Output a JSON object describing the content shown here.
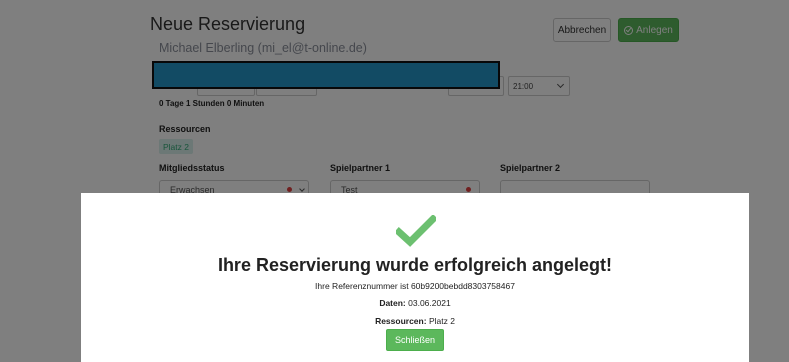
{
  "form": {
    "title": "Neue Reservierung",
    "user": "Michael Elberling (mi_el@t-online.de)",
    "cancel_label": "Abbrechen",
    "create_label": "Anlegen",
    "end_time": "21:00",
    "duration": "0 Tage 1 Stunden 0 Minuten",
    "resources_label": "Ressourcen",
    "resource_tag": "Platz 2",
    "membership_label": "Mitgliedsstatus",
    "membership_value": "Erwachsen",
    "partner1_label": "Spielpartner 1",
    "partner1_value": "Test",
    "partner2_label": "Spielpartner 2",
    "partner2_value": ""
  },
  "modal": {
    "icon": "check-icon",
    "title": "Ihre Reservierung wurde erfolgreich angelegt!",
    "reference": "Ihre Referenznummer ist 60b9200bebdd8303758467",
    "date_label": "Daten:",
    "date_value": "03.06.2021",
    "resources_label": "Ressourcen:",
    "resources_value": "Platz 2",
    "close_label": "Schließen"
  },
  "colors": {
    "success": "#5cb85c",
    "check": "#6cc070",
    "redaction": "#2596c8",
    "overlay": "rgba(0,0,0,0.5)"
  }
}
